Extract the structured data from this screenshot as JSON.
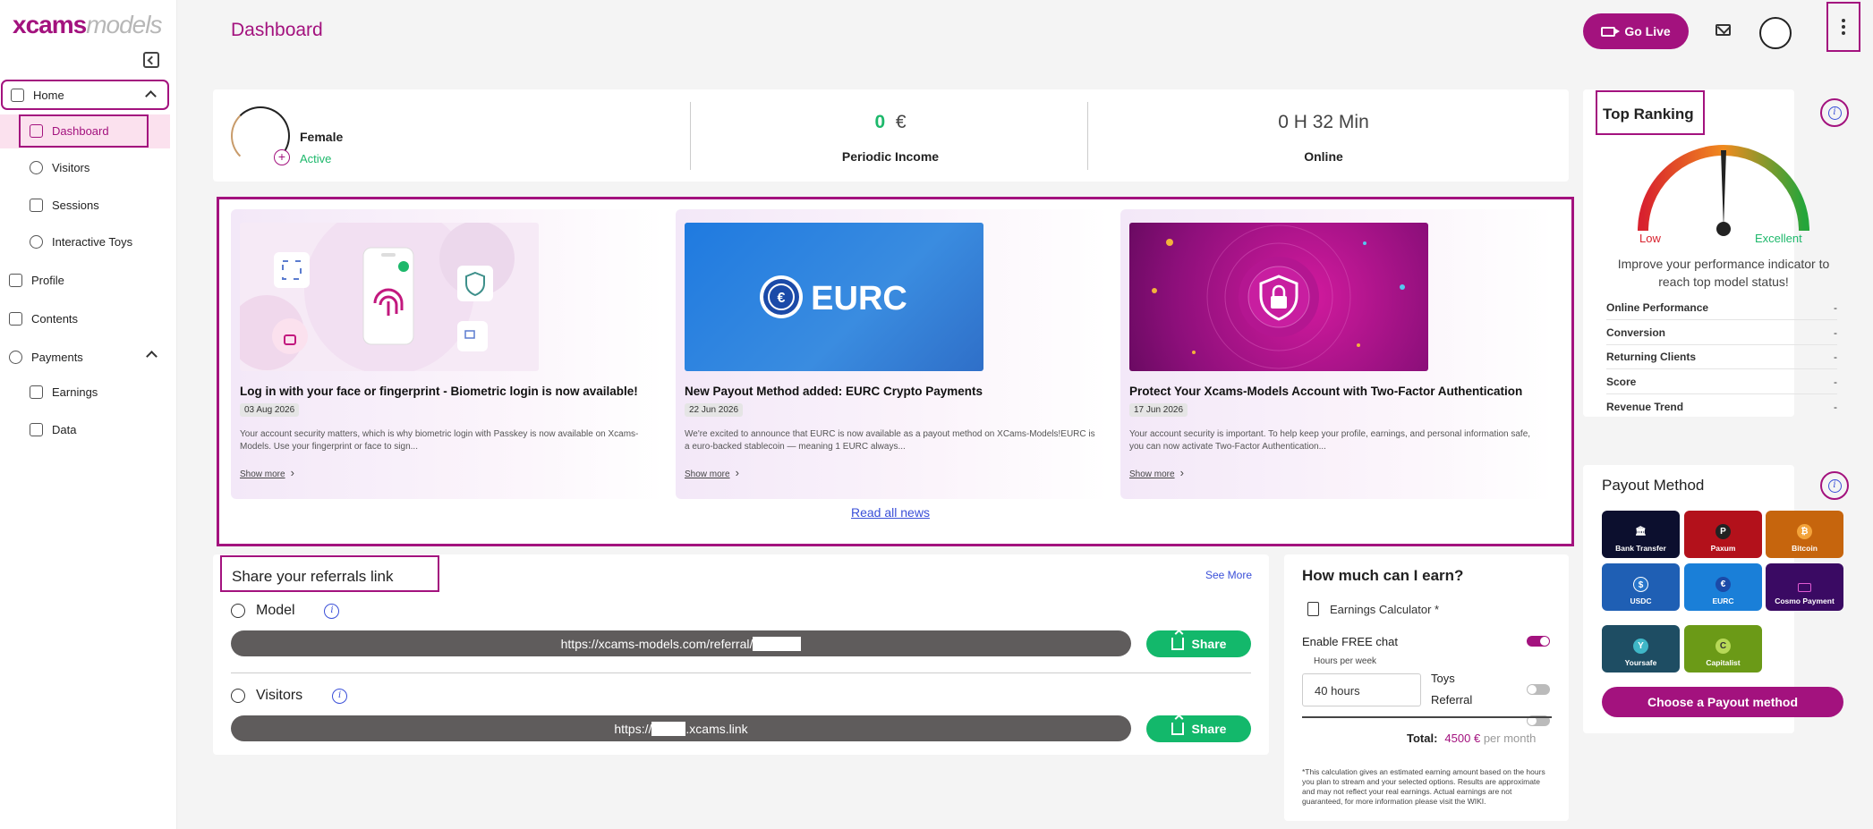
{
  "brand": {
    "part1": "xcams",
    "part2": "models"
  },
  "sidebar": {
    "items": [
      {
        "label": "Home"
      },
      {
        "label": "Dashboard"
      },
      {
        "label": "Visitors"
      },
      {
        "label": "Sessions"
      },
      {
        "label": "Interactive Toys"
      },
      {
        "label": "Profile"
      },
      {
        "label": "Contents"
      },
      {
        "label": "Payments"
      },
      {
        "label": "Earnings"
      },
      {
        "label": "Data"
      }
    ]
  },
  "header": {
    "title": "Dashboard",
    "go_live": "Go Live"
  },
  "profile": {
    "name": "Female",
    "status": "Active"
  },
  "stats": {
    "income_value": "0",
    "income_currency": "€",
    "income_label": "Periodic Income",
    "online_value": "0 H 32 Min",
    "online_label": "Online"
  },
  "news": {
    "items": [
      {
        "title": "Log in with your face or fingerprint - Biometric login is now available!",
        "date": "03 Aug 2026",
        "summary": "Your account security matters, which is why biometric login with Passkey is now available on Xcams-Models. Use your fingerprint or face to sign...",
        "more": "Show more"
      },
      {
        "title": "New Payout Method added: EURC Crypto Payments",
        "date": "22 Jun 2026",
        "summary": "We're excited to announce that EURC is now available as a payout method on XCams-Models!EURC is a euro-backed stablecoin — meaning 1 EURC always...",
        "more": "Show more",
        "image_text": "EURC"
      },
      {
        "title": "Protect Your Xcams-Models Account with Two-Factor Authentication",
        "date": "17 Jun 2026",
        "summary": "Your account security is important. To help keep your profile, earnings, and personal information safe, you can now activate Two-Factor Authentication...",
        "more": "Show more"
      }
    ],
    "read_all": "Read all news"
  },
  "ranking": {
    "title": "Top Ranking",
    "low": "Low",
    "excellent": "Excellent",
    "description": "Improve your performance indicator to reach top model status!",
    "metrics": [
      {
        "label": "Online Performance",
        "value": "-"
      },
      {
        "label": "Conversion",
        "value": "-"
      },
      {
        "label": "Returning Clients",
        "value": "-"
      },
      {
        "label": "Score",
        "value": "-"
      },
      {
        "label": "Revenue Trend",
        "value": "-"
      }
    ]
  },
  "referral": {
    "title": "Share your referrals link",
    "see_more": "See More",
    "model_label": "Model",
    "model_url": "https://xcams-models.com/referral/",
    "visitors_label": "Visitors",
    "visitors_url_prefix": "https://",
    "visitors_url_suffix": ".xcams.link",
    "share": "Share"
  },
  "calculator": {
    "title": "How much can I earn?",
    "subtitle": "Earnings Calculator *",
    "free_chat": "Enable FREE chat",
    "free_chat_on": true,
    "hours_label": "Hours per week",
    "hours_value": "40 hours",
    "toys": "Toys",
    "toys_on": false,
    "referral": "Referral",
    "referral_on": false,
    "total_label": "Total:",
    "total_value": "4500 €",
    "per_month": "per month",
    "disclaimer": "*This calculation gives an estimated earning amount based on the hours you plan to stream and your selected options. Results are approximate and may not reflect your real earnings. Actual earnings are not guaranteed, for more information please visit the WIKI."
  },
  "payout": {
    "title": "Payout Method",
    "methods": [
      {
        "label": "Bank Transfer",
        "icon": "bank-icon",
        "color": "#0c0f2e"
      },
      {
        "label": "Paxum",
        "icon": "paxum-icon",
        "color": "#b3111b"
      },
      {
        "label": "Bitcoin",
        "icon": "bitcoin-icon",
        "color": "#c6650d"
      },
      {
        "label": "USDC",
        "icon": "usdc-icon",
        "color": "#1f5fb4"
      },
      {
        "label": "EURC",
        "icon": "eurc-icon",
        "color": "#1a7fd8"
      },
      {
        "label": "Cosmo Payment",
        "icon": "cosmo-icon",
        "color": "#3a0a63"
      },
      {
        "label": "Yoursafe",
        "icon": "yoursafe-icon",
        "color": "#1e4d63"
      },
      {
        "label": "Capitalist",
        "icon": "capitalist-icon",
        "color": "#6b9a17"
      }
    ],
    "choose": "Choose a Payout method"
  },
  "colors": {
    "accent": "#a3127e",
    "success": "#13b86b",
    "link": "#3a4fd8"
  }
}
